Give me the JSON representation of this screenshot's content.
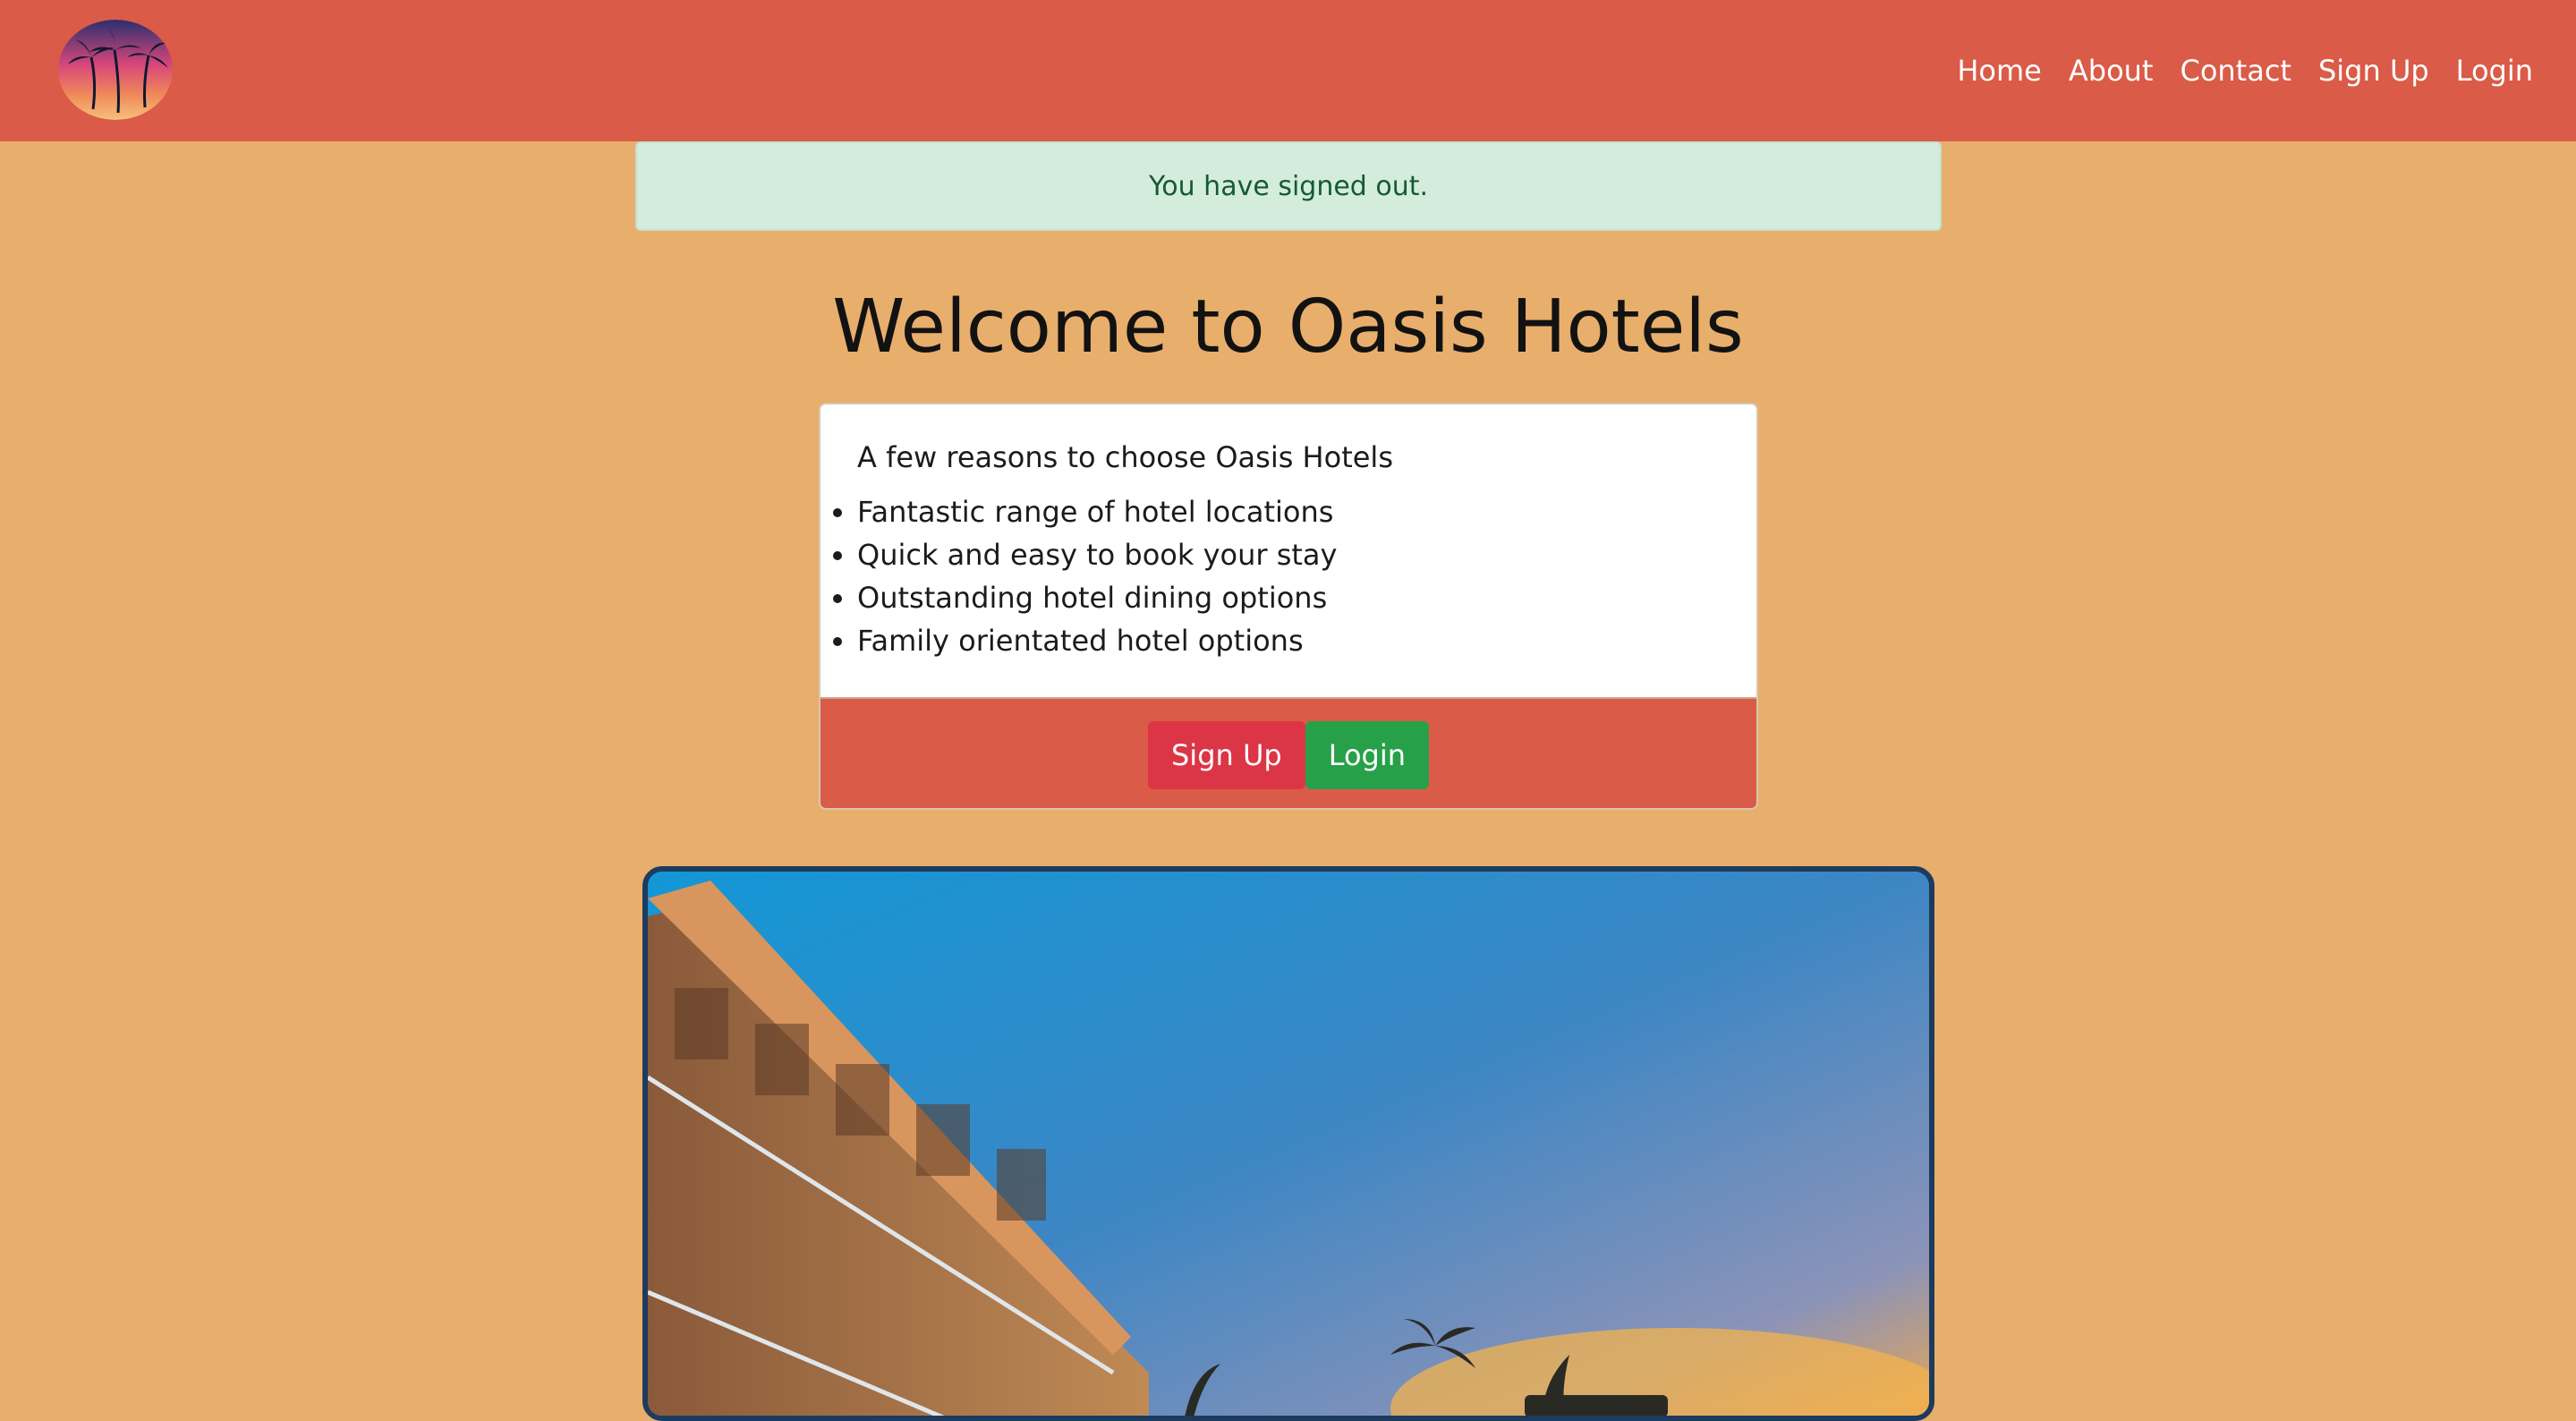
{
  "navbar": {
    "logo_icon": "palm-tree-sunset-logo-icon",
    "links": [
      "Home",
      "About",
      "Contact",
      "Sign Up",
      "Login"
    ]
  },
  "alert": {
    "message": "You have signed out."
  },
  "main": {
    "heading": "Welcome to Oasis Hotels"
  },
  "card": {
    "title": "A few reasons to choose Oasis Hotels",
    "reasons": [
      "Fantastic range of hotel locations",
      "Quick and easy to book your stay",
      "Outstanding hotel dining options",
      "Family orientated hotel options"
    ],
    "signup_label": "Sign Up",
    "login_label": "Login"
  },
  "hero": {
    "image": "hotel-exterior-sunset-photo"
  },
  "colors": {
    "page_background": "#e8ae6c",
    "navbar": "#da5b47",
    "alert_background": "#d4ecdc",
    "signup_button": "#dc3545",
    "login_button": "#27a04a"
  }
}
